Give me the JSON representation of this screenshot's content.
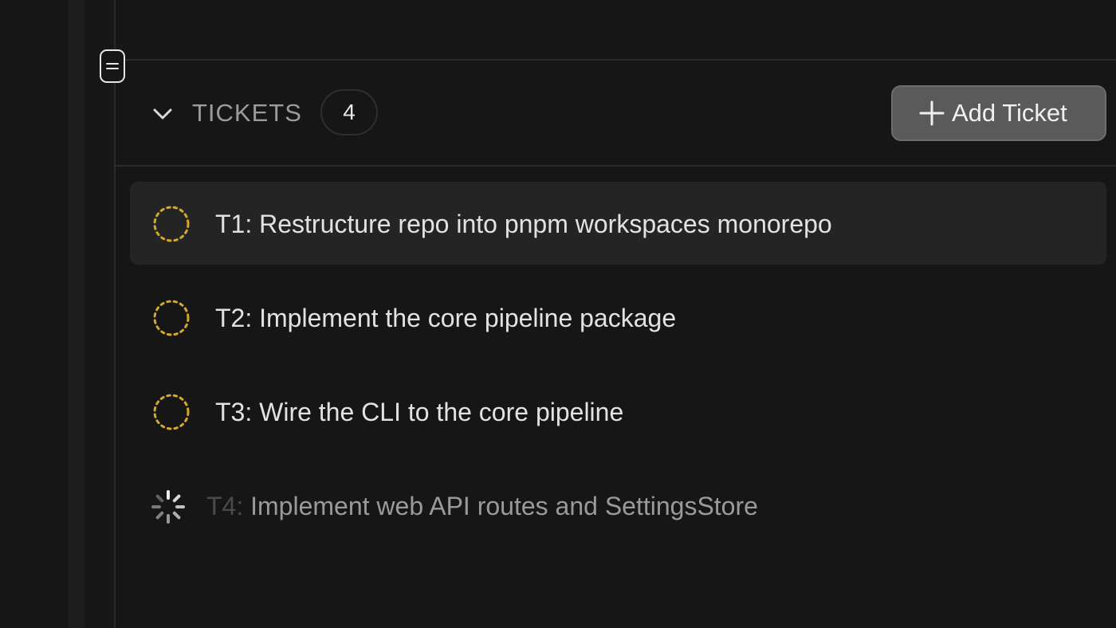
{
  "section": {
    "title": "TICKETS",
    "count": "4",
    "add_button_label": "Add Ticket"
  },
  "tickets": [
    {
      "id": "T1:",
      "title": "Restructure repo into pnpm workspaces monorepo",
      "status": "pending"
    },
    {
      "id": "T2:",
      "title": "Implement the core pipeline package",
      "status": "pending"
    },
    {
      "id": "T3:",
      "title": "Wire the CLI to the core pipeline",
      "status": "pending"
    },
    {
      "id": "T4:",
      "title": "Implement web API routes and SettingsStore",
      "status": "loading"
    }
  ],
  "icons": {
    "drag_handle": "drag-handle-icon",
    "collapse": "chevron-down-icon",
    "add": "plus-icon",
    "pending": "dashed-circle-icon",
    "loading": "spinner-icon"
  },
  "colors": {
    "background": "#161616",
    "pending_status": "#d4a82a",
    "button_bg": "#5a5a5a",
    "hover_row": "#242424",
    "text_primary": "#e2e2e2",
    "text_muted": "#9b9b9b"
  }
}
